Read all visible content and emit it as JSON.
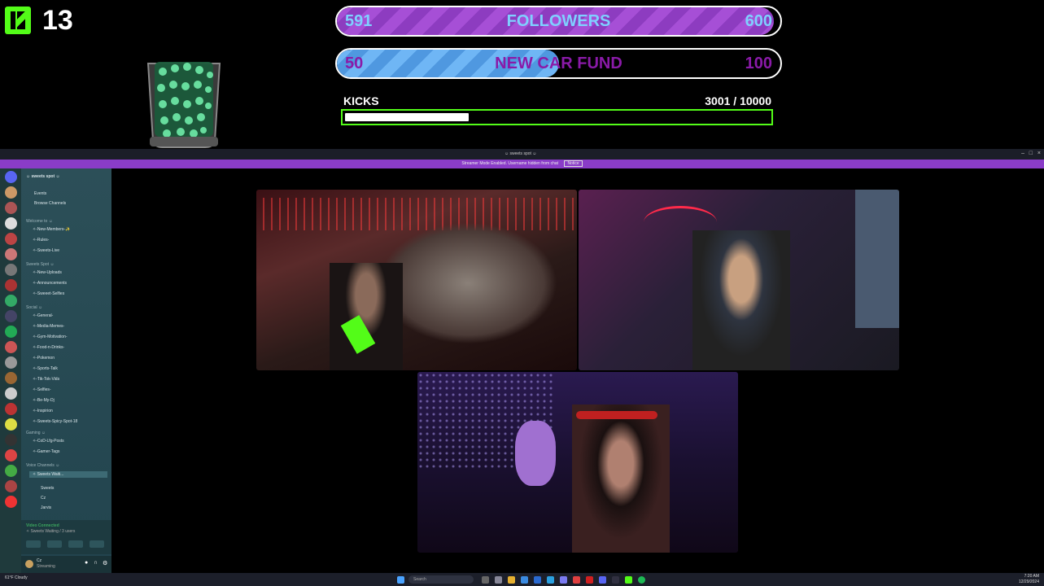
{
  "overlay": {
    "kick_count": "13",
    "followers": {
      "current": "591",
      "label": "FOLLOWERS",
      "goal": "600",
      "progress": 0.985
    },
    "car_fund": {
      "current": "50",
      "label": "NEW CAR FUND",
      "goal": "100",
      "progress": 0.5
    },
    "kicks": {
      "label": "KICKS",
      "value": "3001  / 10000",
      "progress": 0.3001
    },
    "colors": {
      "kick_green": "#53fc18",
      "followers_purple": "#a64fd6",
      "car_blue": "#5aa9f0"
    }
  },
  "window": {
    "title": "☺ sweets spot ☺",
    "notice": "Streamer Mode Enabled. Username hidden from chat",
    "notice_button": "Notice",
    "server_name": "☺ sweets spot ☺",
    "top_items": [
      "Events",
      "Browse Channels"
    ],
    "categories": [
      {
        "name": "Welcome to ☺",
        "channels": [
          "✧-New-Members-✨",
          "✧-Rules-",
          "✧-Sweets-Live"
        ]
      },
      {
        "name": "Sweets Spot ☺",
        "channels": [
          "✧-New-Uploads",
          "✧-Announcements",
          "✧-Sweeet-Selfies"
        ]
      },
      {
        "name": "Social ☺",
        "channels": [
          "✧-General-",
          "✧-Media-Memes-",
          "✧-Gym-Motivation-",
          "✧-Food-n-Drinks-",
          "✧-Pokemon",
          "✧-Sports-Talk",
          "✧-Tik-Tok-Vids",
          "✧-Selfies-",
          "✧-Be-My-Dj",
          "✧-Inspirion",
          "✧-Sweets-Spicy-Spot-18"
        ]
      },
      {
        "name": "Gaming ☺",
        "channels": [
          "✧-CoD-Lfg-Posts",
          "✧-Gamer-Tags"
        ]
      },
      {
        "name": "Voice Channels ☺",
        "channels": [
          "✧ Sweets Waiti..."
        ]
      }
    ],
    "voice_users": [
      "Sweets",
      "Cz",
      "Jarvis"
    ],
    "video_status": "Video Connected",
    "video_sub": "✧ Sweets Waiting / 3 users",
    "user_name": "Cz",
    "user_status": "Streaming",
    "weather": "61°F Cloudy",
    "search_placeholder": "Search",
    "clock_time": "7:20 AM",
    "clock_date": "12/29/2024"
  }
}
